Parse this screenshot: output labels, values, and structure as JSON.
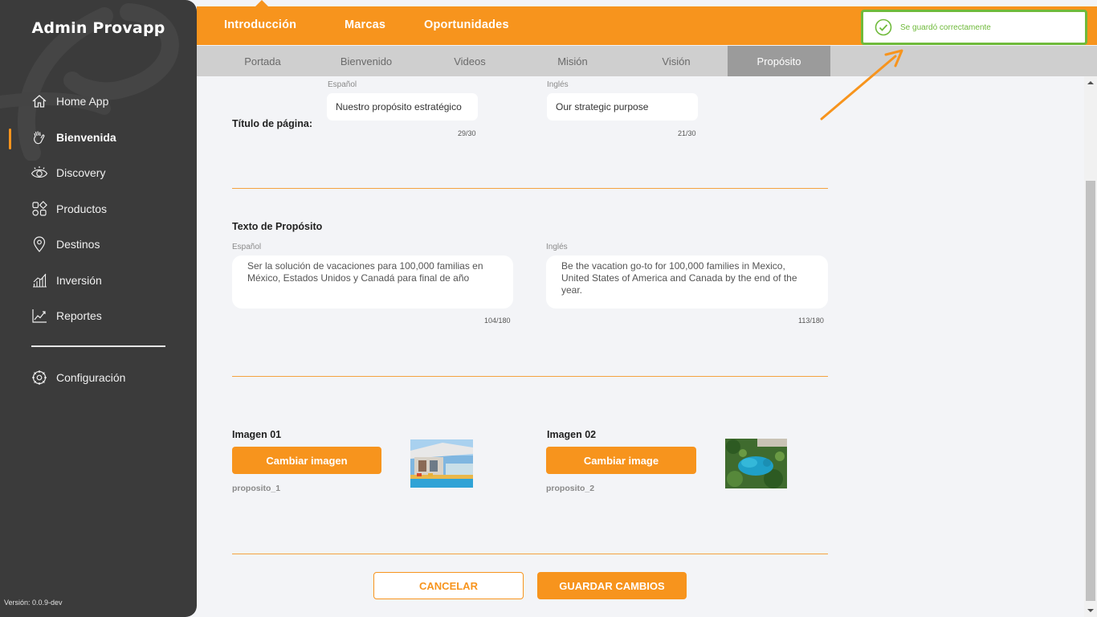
{
  "app": {
    "title": "Admin Provapp",
    "version": "Versión: 0.0.9-dev"
  },
  "sidebar": {
    "items": [
      {
        "label": "Home App",
        "icon": "home-icon"
      },
      {
        "label": "Bienvenida",
        "icon": "waving-hand-icon",
        "active": true
      },
      {
        "label": "Discovery",
        "icon": "eye-icon"
      },
      {
        "label": "Productos",
        "icon": "grid-shapes-icon"
      },
      {
        "label": "Destinos",
        "icon": "location-pin-icon"
      },
      {
        "label": "Inversión",
        "icon": "bar-chart-icon"
      },
      {
        "label": "Reportes",
        "icon": "line-chart-icon"
      }
    ],
    "settings": {
      "label": "Configuración",
      "icon": "gear-icon"
    }
  },
  "topnav": {
    "tabs": [
      "Introducción",
      "Marcas",
      "Oportunidades"
    ],
    "active": "Introducción"
  },
  "subnav": {
    "tabs": [
      "Portada",
      "Bienvenido",
      "Videos",
      "Misión",
      "Visión",
      "Propósito"
    ],
    "active": "Propósito"
  },
  "toast": {
    "message": "Se guardó correctamente",
    "icon": "check-circle-icon",
    "color": "#6fba3b"
  },
  "title_section": {
    "label": "Título de página:",
    "es": {
      "lang": "Español",
      "value": "Nuestro propósito estratégico",
      "counter": "29/30"
    },
    "en": {
      "lang": "Inglés",
      "value": "Our strategic purpose",
      "counter": "21/30"
    }
  },
  "text_section": {
    "label": "Texto de Propósito",
    "es": {
      "lang": "Español",
      "value": "Ser la solución de vacaciones para 100,000 familias en México, Estados Unidos y Canadá para final de año",
      "counter": "104/180"
    },
    "en": {
      "lang": "Inglés",
      "value": "Be the vacation go-to for 100,000 families in Mexico, United States of America and Canada by the end of the year.",
      "counter": "113/180"
    }
  },
  "images": {
    "img1": {
      "label": "Imagen 01",
      "button": "Cambiar imagen",
      "filename": "proposito_1"
    },
    "img2": {
      "label": "Imagen 02",
      "button": "Cambiar image",
      "filename": "proposito_2"
    }
  },
  "actions": {
    "cancel": "CANCELAR",
    "save": "GUARDAR CAMBIOS"
  },
  "colors": {
    "accent": "#f7941d",
    "sidebar": "#3b3b3b",
    "success": "#6fba3b"
  }
}
